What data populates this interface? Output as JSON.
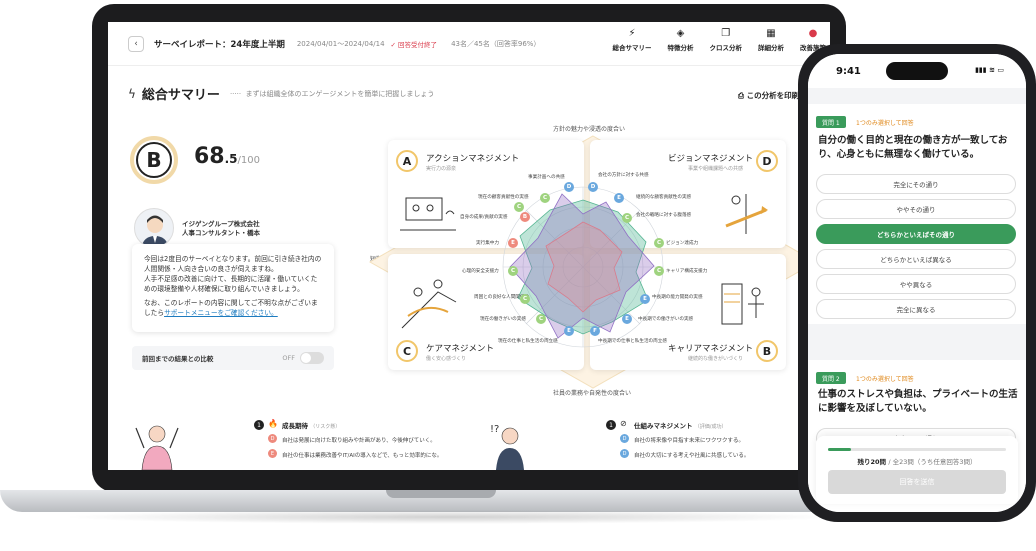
{
  "header": {
    "back_icon": "chevron-left-icon",
    "title": "サーベイレポート：24年度上半期",
    "period": "2024/04/01〜2024/04/14",
    "status": "✓ 回答受付終了",
    "responses": "43名／45名（回答率96%）",
    "tabs": [
      {
        "label": "総合サマリー",
        "icon": "bolt-icon"
      },
      {
        "label": "特徴分析",
        "icon": "layers-icon"
      },
      {
        "label": "クロス分析",
        "icon": "copy-icon"
      },
      {
        "label": "詳細分析",
        "icon": "grid-icon"
      },
      {
        "label": "改善施策",
        "icon": "bag-icon"
      }
    ]
  },
  "summary": {
    "title": "総合サマリー",
    "description": "まずは組織全体のエンゲージメントを簡単に把握しましょう",
    "print_label": "この分析を印刷"
  },
  "score": {
    "grade": "B",
    "value": "68",
    "decimal": ".5",
    "max": "/100"
  },
  "consultant": {
    "company": "イジゲングループ株式会社",
    "role": "人事コンサルタント・橋本",
    "message_1": "今回は2度目のサーベイとなります。前回に引き続き社内の人間関係・人向き合いの良さが伺えますね。",
    "message_2": "人手不足感の改善に向けて、長期的に活躍・働いていくための環境整備や人材確保に取り組んでいきましょう。",
    "message_3": "なお、このレポートの内容に関してご不明な点がございましたら",
    "link": "サポートメニューをご確認ください。",
    "compare_label": "前回までの結果との比較",
    "toggle_state": "OFF"
  },
  "radar": {
    "axis_top": "方針の魅力や浸透の度合い",
    "axis_bottom": "社員の業務や自発性の度合い",
    "axis_left": "短期",
    "axis_right": "中長",
    "quadrants": [
      {
        "grade": "A",
        "title": "アクションマネジメント",
        "sub": "実行力の源泉"
      },
      {
        "grade": "D",
        "title": "ビジョンマネジメント",
        "sub": "事業や組織課題への共感"
      },
      {
        "grade": "C",
        "title": "ケアマネジメント",
        "sub": "働く安心感づくり"
      },
      {
        "grade": "B",
        "title": "キャリアマネジメント",
        "sub": "継続的な働きがいづくり"
      }
    ],
    "items_left_top": [
      "事業計画への共感",
      "現在の顧客貢献性の実感",
      "自身の成果/貢献の実感",
      "実行集中力"
    ],
    "items_right_top": [
      "会社の方針に対する共感",
      "継続的な顧客貢献性の実感",
      "会社の戦略に対する腹落感",
      "ビジョン達成力"
    ],
    "items_left_bottom": [
      "心理的安全支援力",
      "周囲との良好な人間関係性",
      "現在の働きがいの実感",
      "現在の仕事と私生活の両立感"
    ],
    "items_right_bottom": [
      "キャリア構成支援力",
      "中長期の能力開発の実感",
      "中長期での働きがいの実感",
      "中長期での仕事と私生活の両立感"
    ],
    "badges_top_left": [
      "D",
      "C",
      "C",
      "B",
      "E"
    ],
    "badges_top_right": [
      "D",
      "E",
      "C",
      "C"
    ],
    "badges_bottom_left": [
      "C",
      "C",
      "C",
      "E"
    ],
    "badges_bottom_right": [
      "C",
      "E",
      "E",
      "F"
    ]
  },
  "bottom": {
    "left_title": "成長期待",
    "left_sub": "（リスク懸）",
    "left_lines": [
      "自社は発展に向けた取り組みや計画があり、今後伸びていく。",
      "自社の仕事は業務改善やIT/AIの導入などで、もっと効率的にな。"
    ],
    "right_title": "仕組みマネジメント",
    "right_sub": "（評価/成功）",
    "right_lines": [
      "自社の将来像や目指す未来にワクワクする。",
      "自社の大切にする考えや社風に共感している。"
    ]
  },
  "phone": {
    "time": "9:41",
    "q1_tag": "質問 1",
    "q1_note": "1つのみ選択して回答",
    "q1_text": "自分の働く目的と現在の働き方が一致しており、心身ともに無理なく働けている。",
    "options": [
      "完全にその通り",
      "ややその通り",
      "どちらかといえばその通り",
      "どちらかといえば異なる",
      "やや異なる",
      "完全に異なる"
    ],
    "selected_index": 2,
    "q2_tag": "質問 2",
    "q2_note": "1つのみ選択して回答",
    "q2_text": "仕事のストレスや負担は、プライベートの生活に影響を及ぼしていない。",
    "q2_option_peek": "完全にその通り",
    "remaining": "残り20問",
    "remaining_detail": "/ 全23問（うち任意回答3問）",
    "progress": 0.13,
    "submit": "回答を送信"
  },
  "colors": {
    "accent_green": "#3a9b5b",
    "grade_ring": "#f1d9a8",
    "link": "#1d7bbf",
    "status_red": "#d93a4a"
  }
}
